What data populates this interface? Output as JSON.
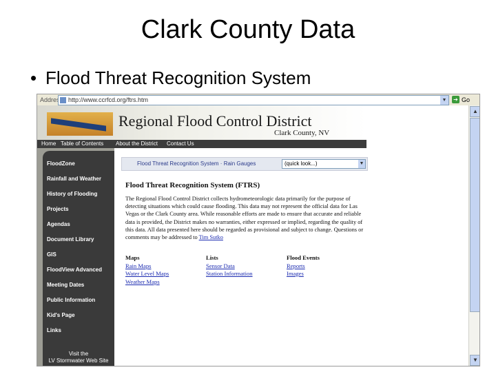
{
  "slide": {
    "title": "Clark County Data",
    "bullet": "Flood Threat Recognition System"
  },
  "browser": {
    "address_label": "Address",
    "url": "http://www.ccrfcd.org/ftrs.htm",
    "go_label": "Go"
  },
  "site": {
    "name": "Regional Flood Control District",
    "subtitle": "Clark County, NV",
    "nav": [
      "Home",
      "Table of Contents",
      "About the District",
      "Contact Us"
    ],
    "sidebar": [
      "FloodZone",
      "Rainfall and Weather",
      "History of Flooding",
      "Projects",
      "Agendas",
      "Document Library",
      "GIS",
      "FloodView Advanced",
      "Meeting Dates",
      "Public Information",
      "Kid's Page",
      "Links"
    ],
    "sidebar_footer": [
      "Visit the",
      "LV Stormwater Web Site"
    ],
    "quicklinks": "Flood Threat Recognition System  ·  Rain Gauges",
    "quicklook_value": "(quick look...)",
    "heading": "Flood Threat Recognition System (FTRS)",
    "body_text": "The Regional Flood Control District collects hydrometeorologic data primarily for the purpose of detecting situations which could cause flooding. This data may not represent the official data for Las Vegas or the Clark County area. While reasonable efforts are made to ensure that accurate and reliable data is provided, the District makes no warranties, either expressed or implied, regarding the quality of this data. All data presented here should be regarded as provisional and subject to change. Questions or comments may be addressed to",
    "contact_link": "Tim Sutko",
    "columns": [
      {
        "heading": "Maps",
        "links": [
          "Rain Maps",
          "Water Level Maps",
          "Weather Maps"
        ]
      },
      {
        "heading": "Lists",
        "links": [
          "Sensor Data",
          "Station Information"
        ]
      },
      {
        "heading": "Flood Events",
        "links": [
          "Reports",
          "Images"
        ]
      }
    ]
  }
}
